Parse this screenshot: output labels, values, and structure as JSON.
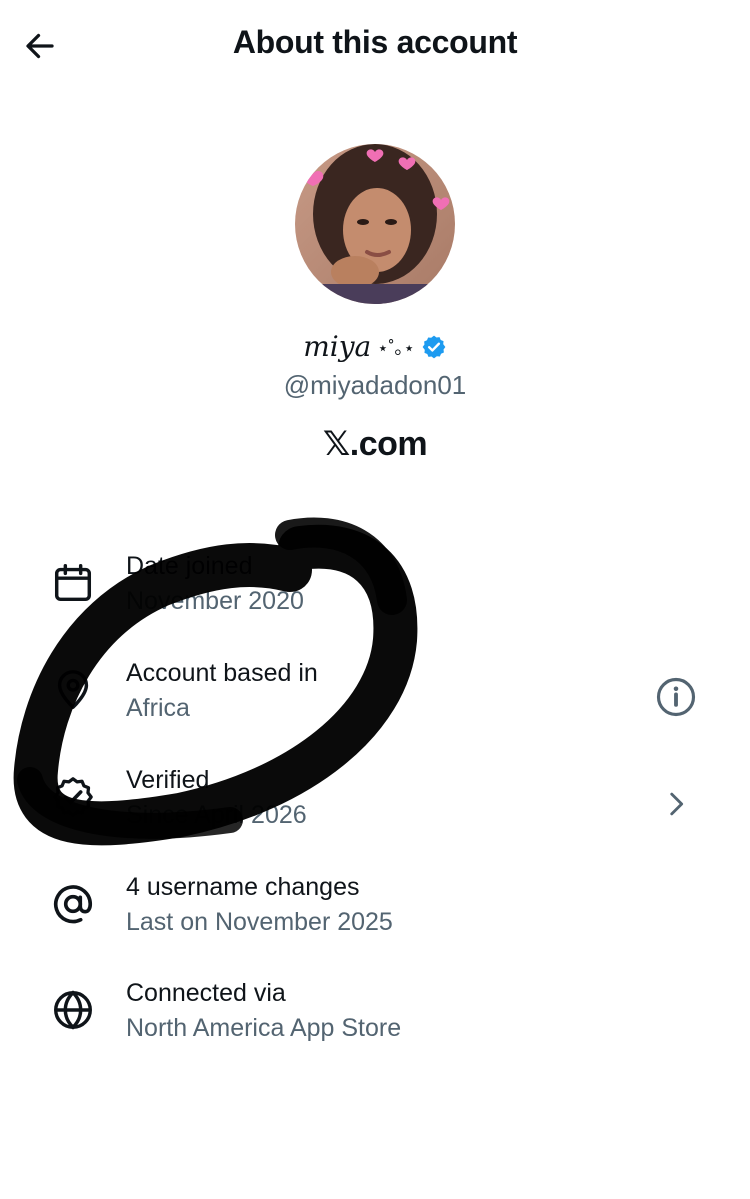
{
  "header": {
    "title": "About this account",
    "back_icon": "arrow-left-icon"
  },
  "profile": {
    "display_name": "miya",
    "display_name_decoration": "⋆˚｡⋆",
    "verified_badge_color": "#1d9bf0",
    "handle": "@miyadadon01"
  },
  "brand": {
    "text": "𝕏.com"
  },
  "rows": [
    {
      "icon": "calendar-icon",
      "title": "Date joined",
      "value": "November 2020"
    },
    {
      "icon": "location-pin-icon",
      "title": "Account based in",
      "value": "Africa",
      "action_icon": "info-icon"
    },
    {
      "icon": "verified-badge-icon",
      "title": "Verified",
      "value": "Since April 2026",
      "action_icon": "chevron-right-icon"
    },
    {
      "icon": "at-sign-icon",
      "title": "4 username changes",
      "value": "Last on November 2025"
    },
    {
      "icon": "globe-icon",
      "title": "Connected via",
      "value": "North America App Store"
    }
  ],
  "colors": {
    "text_primary": "#0f1419",
    "text_secondary": "#536471",
    "annotation": "#000000"
  }
}
